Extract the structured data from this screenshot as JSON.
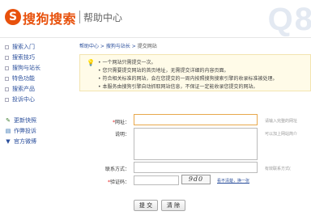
{
  "header": {
    "logo_mark": "S",
    "logo_text": "搜狗搜索",
    "subtitle": "帮助中心",
    "watermark": "Q8"
  },
  "sidebar": {
    "items": [
      {
        "label": "搜索入门",
        "icon": "square-bullet-icon"
      },
      {
        "label": "搜索技巧",
        "icon": "square-bullet-icon"
      },
      {
        "label": "搜狗与站长",
        "icon": "square-bullet-icon"
      },
      {
        "label": "特色功能",
        "icon": "square-bullet-icon"
      },
      {
        "label": "搜索产品",
        "icon": "square-bullet-icon"
      },
      {
        "label": "投诉中心",
        "icon": "square-bullet-icon"
      },
      {
        "label": "更新快照",
        "icon": "pencil-icon"
      },
      {
        "label": "作弊投诉",
        "icon": "document-icon"
      },
      {
        "label": "官方微博",
        "icon": "weibo-icon"
      }
    ]
  },
  "breadcrumb": {
    "items": [
      "帮助中心",
      "搜狗与站长",
      "提交网站"
    ],
    "separator": " > "
  },
  "notice": {
    "lines": [
      "• 一个网站只需提交一次。",
      "• 您只需要提交网站的首页地址，无需提交详细的内容页面。",
      "• 符合相关标准的网站，会在您提交的一周内按照搜狗搜索引擎的收录标准被处理。",
      "• 本服务由搜狗引擎自动抓取网站信息，不保证一定能收录您提交的网站。"
    ]
  },
  "form": {
    "url_label": "网址：",
    "url_value": "",
    "url_hint": "请输入完整的网址",
    "desc_label": "说明：",
    "desc_value": "",
    "desc_hint": "可以加上网站简介",
    "contact_label": "联系方式：",
    "contact_value": "",
    "contact_hint": "有效联系方式(",
    "captcha_label": "验证码：",
    "captcha_value": "",
    "captcha_image_text": "9d0",
    "captcha_refresh": "看不清楚，换一张",
    "submit_label": "提 交",
    "clear_label": "清 除"
  },
  "colors": {
    "brand": "#e8510c",
    "link": "#2b4f9c",
    "notice_bg": "#fffbe8",
    "required": "#e02020"
  }
}
